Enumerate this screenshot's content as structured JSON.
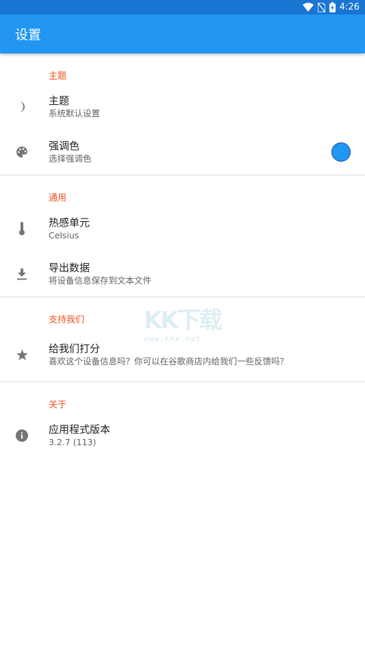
{
  "statusbar": {
    "time": "4:26"
  },
  "appbar": {
    "title": "设置"
  },
  "sections": [
    {
      "header": "主题",
      "items": [
        {
          "icon": "moon-icon",
          "title": "主题",
          "subtitle": "系统默认设置"
        },
        {
          "icon": "palette-icon",
          "title": "强调色",
          "subtitle": "选择强调色",
          "accent_color": "#2196F3"
        }
      ]
    },
    {
      "header": "通用",
      "items": [
        {
          "icon": "thermometer-icon",
          "title": "热感单元",
          "subtitle": "Celsius"
        },
        {
          "icon": "download-icon",
          "title": "导出数据",
          "subtitle": "将设备信息保存到文本文件"
        }
      ]
    },
    {
      "header": "支持我们",
      "items": [
        {
          "icon": "star-icon",
          "title": "给我们打分",
          "subtitle": "喜欢这个设备信息吗？你可以在谷歌商店内给我们一些反馈吗？"
        }
      ]
    },
    {
      "header": "关于",
      "items": [
        {
          "icon": "info-icon",
          "title": "应用程式版本",
          "subtitle": "3.2.7 (113)"
        }
      ]
    }
  ],
  "watermark": {
    "big": "KK下载",
    "small": "www.kkx.net"
  },
  "colors": {
    "primary": "#2196F3",
    "status_bar": "#1976D2",
    "section_header": "#F4511E"
  }
}
